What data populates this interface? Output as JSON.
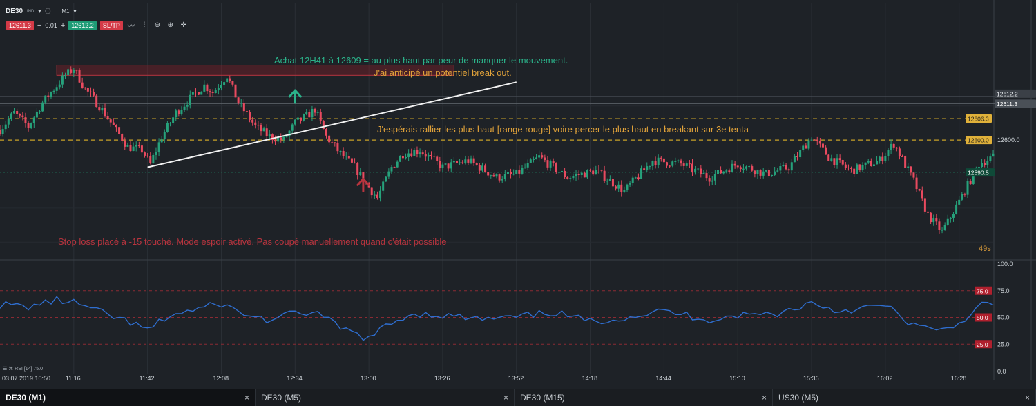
{
  "toolbar": {
    "symbol": "DE30",
    "symbol_tag": "IND",
    "timeframe": "M1",
    "bid": "12611.3",
    "spread_value": "0.01",
    "ask": "12612.2",
    "sltp_label": "SL/TP"
  },
  "annotations": {
    "buy_note": "Achat 12H41 à 12609 = au plus haut par peur de manquer le mouvement.",
    "breakout_note": "J'ai anticipé un potentiel break out.",
    "hope_note": "J'espérais rallier les plus haut [range rouge] voire percer le plus haut en breakant sur 3e tenta",
    "stop_note": "Stop loss placé à -15 touché. Mode espoir activé. Pas coupé manuellement quand c'était possible"
  },
  "price_axis": {
    "labels": {
      "ask_tag": "12612.2",
      "bid_tag": "12611.3",
      "level_high": "12606.3",
      "level_mid": "12600.0",
      "level_mid_plain": "12600.0",
      "current": "12590.5",
      "timer": "49s"
    }
  },
  "rsi": {
    "legend": "RSI [14] 75.0",
    "axis_labels": {
      "top": "100.0",
      "upper": "75.0",
      "mid": "50.0",
      "lower": "25.0",
      "bottom": "0.0"
    },
    "tags": {
      "upper": "75.0",
      "mid": "50.0",
      "lower": "25.0"
    }
  },
  "time_axis": {
    "labels": [
      "03.07.2019 10:50",
      "11:16",
      "11:42",
      "12:08",
      "12:34",
      "13:00",
      "13:26",
      "13:52",
      "14:18",
      "14:44",
      "15:10",
      "15:36",
      "16:02",
      "16:28"
    ]
  },
  "tabs": [
    {
      "label": "DE30 (M1)",
      "active": true
    },
    {
      "label": "DE30 (M5)",
      "active": false
    },
    {
      "label": "DE30 (M15)",
      "active": false
    },
    {
      "label": "US30 (M5)",
      "active": false
    }
  ],
  "colors": {
    "background": "#1e2227",
    "bull": "#26a17b",
    "bear": "#e84a5f",
    "rsi_line": "#2f6ecf",
    "level_line": "#c9a227",
    "annotation_green": "#2bb38a",
    "annotation_orange": "#e0a23a",
    "annotation_red": "#b8343e"
  },
  "chart_data": {
    "type": "candlestick",
    "instrument": "DE30",
    "timeframe": "M1",
    "x_start": "2019-07-03 10:50",
    "x_end": "2019-07-03 16:40",
    "ylim": [
      12565,
      12630
    ],
    "grid": true,
    "horizontal_levels": [
      12606.3,
      12600.0
    ],
    "current_price": 12590.5,
    "price_path": [
      [
        "10:50",
        12603
      ],
      [
        "10:55",
        12608
      ],
      [
        "11:00",
        12604
      ],
      [
        "11:05",
        12611
      ],
      [
        "11:10",
        12616
      ],
      [
        "11:13",
        12619
      ],
      [
        "11:16",
        12621
      ],
      [
        "11:20",
        12615
      ],
      [
        "11:25",
        12610
      ],
      [
        "11:30",
        12604
      ],
      [
        "11:35",
        12598
      ],
      [
        "11:40",
        12597
      ],
      [
        "11:43",
        12593
      ],
      [
        "11:47",
        12601
      ],
      [
        "11:52",
        12608
      ],
      [
        "11:58",
        12613
      ],
      [
        "12:02",
        12616
      ],
      [
        "12:05",
        12614
      ],
      [
        "12:10",
        12619
      ],
      [
        "12:14",
        12611
      ],
      [
        "12:20",
        12604
      ],
      [
        "12:25",
        12601
      ],
      [
        "12:30",
        12600
      ],
      [
        "12:34",
        12605
      ],
      [
        "12:38",
        12607
      ],
      [
        "12:41",
        12609
      ],
      [
        "12:45",
        12601
      ],
      [
        "12:50",
        12596
      ],
      [
        "12:55",
        12592
      ],
      [
        "13:00",
        12586
      ],
      [
        "13:03",
        12583
      ],
      [
        "13:08",
        12592
      ],
      [
        "13:12",
        12596
      ],
      [
        "13:18",
        12597
      ],
      [
        "13:26",
        12592
      ],
      [
        "13:35",
        12594
      ],
      [
        "13:45",
        12589
      ],
      [
        "13:52",
        12590
      ],
      [
        "14:00",
        12595
      ],
      [
        "14:10",
        12589
      ],
      [
        "14:20",
        12591
      ],
      [
        "14:30",
        12585
      ],
      [
        "14:40",
        12594
      ],
      [
        "14:50",
        12593
      ],
      [
        "15:00",
        12589
      ],
      [
        "15:10",
        12593
      ],
      [
        "15:20",
        12590
      ],
      [
        "15:28",
        12592
      ],
      [
        "15:36",
        12601
      ],
      [
        "15:42",
        12595
      ],
      [
        "15:50",
        12591
      ],
      [
        "16:00",
        12594
      ],
      [
        "16:05",
        12599
      ],
      [
        "16:12",
        12588
      ],
      [
        "16:17",
        12578
      ],
      [
        "16:22",
        12573
      ],
      [
        "16:28",
        12582
      ],
      [
        "16:35",
        12593
      ],
      [
        "16:40",
        12595
      ]
    ],
    "trendline": [
      [
        "11:42",
        12592
      ],
      [
        "13:52",
        12617
      ]
    ],
    "resistance_zone": {
      "x": [
        "11:10",
        "13:30"
      ],
      "y": [
        12619,
        12622
      ]
    },
    "arrows": [
      {
        "time": "12:34",
        "price": 12613,
        "direction": "up",
        "color": "#2bb38a"
      },
      {
        "time": "12:58",
        "price": 12587,
        "direction": "up",
        "color": "#b8343e"
      }
    ],
    "rsi": {
      "period": 14,
      "ylim": [
        0,
        100
      ],
      "levels": [
        75,
        50,
        25
      ],
      "values": [
        [
          "10:50",
          62
        ],
        [
          "11:00",
          60
        ],
        [
          "11:10",
          66
        ],
        [
          "11:16",
          64
        ],
        [
          "11:25",
          55
        ],
        [
          "11:35",
          46
        ],
        [
          "11:42",
          38
        ],
        [
          "11:50",
          52
        ],
        [
          "12:00",
          58
        ],
        [
          "12:08",
          63
        ],
        [
          "12:15",
          54
        ],
        [
          "12:25",
          47
        ],
        [
          "12:34",
          54
        ],
        [
          "12:41",
          55
        ],
        [
          "12:50",
          40
        ],
        [
          "13:00",
          30
        ],
        [
          "13:05",
          40
        ],
        [
          "13:15",
          54
        ],
        [
          "13:26",
          52
        ],
        [
          "13:40",
          48
        ],
        [
          "13:52",
          50
        ],
        [
          "14:05",
          55
        ],
        [
          "14:18",
          46
        ],
        [
          "14:30",
          50
        ],
        [
          "14:44",
          56
        ],
        [
          "15:00",
          48
        ],
        [
          "15:10",
          52
        ],
        [
          "15:25",
          54
        ],
        [
          "15:36",
          64
        ],
        [
          "15:45",
          56
        ],
        [
          "16:02",
          61
        ],
        [
          "16:10",
          46
        ],
        [
          "16:20",
          36
        ],
        [
          "16:28",
          44
        ],
        [
          "16:35",
          62
        ],
        [
          "16:40",
          60
        ]
      ]
    }
  }
}
